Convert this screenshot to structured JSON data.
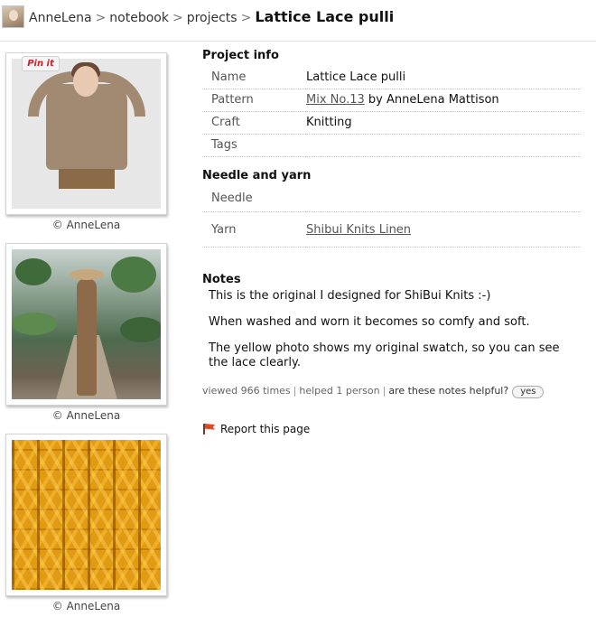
{
  "breadcrumb": {
    "user": "AnneLena",
    "notebook": "notebook",
    "projects": "projects",
    "current": "Lattice Lace pulli",
    "separator": ">"
  },
  "photos": {
    "pinit_label": "Pin it",
    "captions": [
      "© AnneLena",
      "© AnneLena",
      "© AnneLena"
    ]
  },
  "project_info": {
    "title": "Project info",
    "rows": {
      "name": {
        "label": "Name",
        "value": "Lattice Lace pulli"
      },
      "pattern": {
        "label": "Pattern",
        "link": "Mix No.13",
        "by": "by AnneLena Mattison"
      },
      "craft": {
        "label": "Craft",
        "value": "Knitting"
      },
      "tags": {
        "label": "Tags",
        "value": ""
      }
    }
  },
  "needle_yarn": {
    "title": "Needle and yarn",
    "needle": {
      "label": "Needle",
      "value": ""
    },
    "yarn": {
      "label": "Yarn",
      "link": "Shibui Knits Linen"
    }
  },
  "notes": {
    "title": "Notes",
    "paragraphs": [
      "This is the original I designed for ShiBui Knits :-)",
      "When washed and worn it becomes so comfy and soft.",
      "The yellow photo shows my original swatch, so you can see the lace clearly."
    ]
  },
  "stats": {
    "viewed": "viewed 966 times",
    "helped": "helped 1 person",
    "question": "are these notes helpful?",
    "yes_label": "yes",
    "separator": "|"
  },
  "report": {
    "label": "Report this page",
    "icon": "flag-icon"
  }
}
